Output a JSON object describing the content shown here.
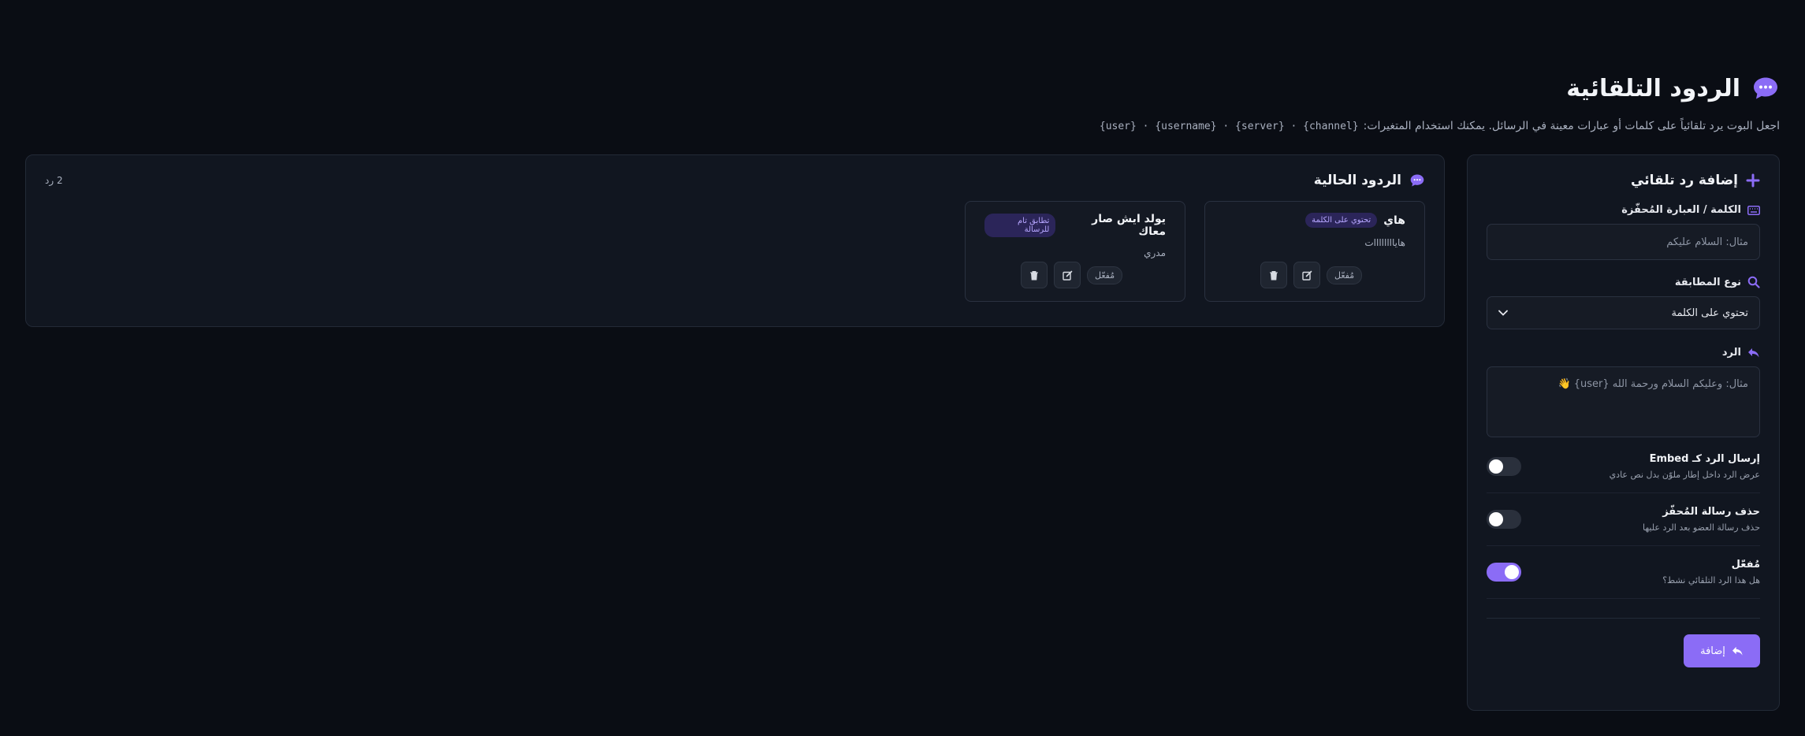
{
  "header": {
    "title": "الردود التلقائية",
    "description": "اجعل البوت يرد تلقائياً على كلمات أو عبارات معينة في الرسائل. يمكنك استخدام المتغيرات:",
    "variables": "{user} · {username} · {server} · {channel}"
  },
  "form": {
    "title": "إضافة رد تلقائي",
    "trigger_label": "الكلمة / العبارة المُحفّزة",
    "trigger_placeholder": "مثال: السلام عليكم",
    "match_label": "نوع المطابقة",
    "match_value": "تحتوي على الكلمة",
    "response_label": "الرد",
    "response_placeholder": "مثال: وعليكم السلام ورحمة الله {user} 👋",
    "toggles": [
      {
        "title": "إرسال الرد كـ Embed",
        "desc": "عرض الرد داخل إطار ملوّن بدل نص عادي",
        "on": false
      },
      {
        "title": "حذف رسالة المُحفّز",
        "desc": "حذف رسالة العضو بعد الرد عليها",
        "on": false
      },
      {
        "title": "مُفعّل",
        "desc": "هل هذا الرد التلقائي نشط؟",
        "on": true
      }
    ],
    "submit_label": "إضافة"
  },
  "list": {
    "title": "الردود الحالية",
    "count": "2 رد",
    "items": [
      {
        "keyword": "هاي",
        "badge": "تحتوي على الكلمة",
        "response": "هاياااااااات",
        "status": "مُفعّل"
      },
      {
        "keyword": "يولد ايش صار معاك",
        "badge": "تطابق تام للرسالة",
        "response": "مدري",
        "status": "مُفعّل"
      }
    ]
  },
  "colors": {
    "background": "#0a0d14",
    "card": "#111620",
    "accent": "#8b6cf6",
    "badge_bg": "#2b2559",
    "badge_text": "#b6a6ff"
  },
  "icons": {
    "title": "chat-bubble-icon",
    "add": "plus-icon",
    "trigger": "keyboard-icon",
    "match": "search-icon",
    "response": "reply-icon",
    "edit": "edit-icon",
    "delete": "trash-icon"
  }
}
